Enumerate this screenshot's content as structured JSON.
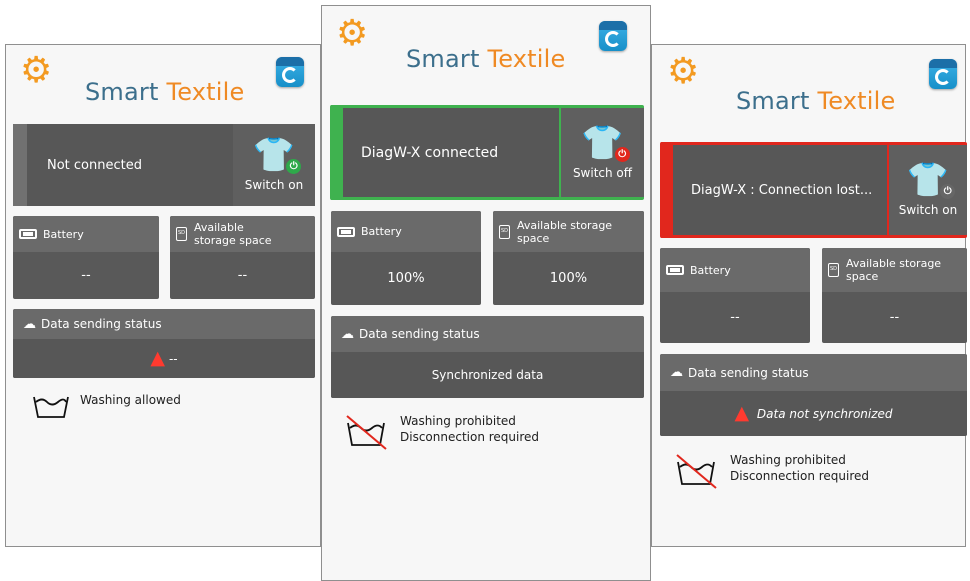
{
  "brand": {
    "word1": "Smart",
    "word2": "Textile"
  },
  "colors": {
    "connected": "#3fb24f",
    "lost": "#e1271d",
    "power_green": "#2ea94a",
    "power_red": "#e1271d",
    "accent": "#ef8a24"
  },
  "screens": [
    {
      "status_text": "Not connected",
      "switch_label": "Switch on",
      "battery_label": "Battery",
      "battery_value": "--",
      "storage_label": "Available storage space",
      "storage_value": "--",
      "data_label": "Data sending status",
      "data_value": "--",
      "wash_line1": "Washing allowed",
      "wash_line2": ""
    },
    {
      "status_text": "DiagW-X connected",
      "switch_label": "Switch off",
      "battery_label": "Battery",
      "battery_value": "100%",
      "storage_label": "Available storage space",
      "storage_value": "100%",
      "data_label": "Data sending status",
      "data_value": "Synchronized data",
      "wash_line1": "Washing prohibited",
      "wash_line2": "Disconnection required"
    },
    {
      "status_text": "DiagW-X : Connection lost...",
      "switch_label": "Switch on",
      "battery_label": "Battery",
      "battery_value": "--",
      "storage_label": "Available storage space",
      "storage_value": "--",
      "data_label": "Data sending status",
      "data_value": "Data not synchronized",
      "wash_line1": "Washing prohibited",
      "wash_line2": "Disconnection required"
    }
  ]
}
